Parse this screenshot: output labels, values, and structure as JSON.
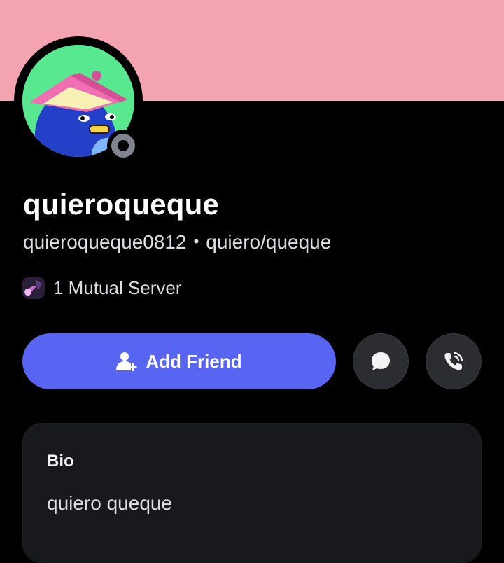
{
  "profile": {
    "banner_color": "#f4a3b1",
    "avatar_icon": "duck-with-book-hat-avatar",
    "status": "offline",
    "display_name": "quieroqueque",
    "username": "quieroqueque0812",
    "separator": "•",
    "pronouns": "quiero/queque"
  },
  "mutual": {
    "server_icon": "server-icon",
    "label": "1 Mutual Server"
  },
  "actions": {
    "add_friend_label": "Add Friend",
    "add_friend_icon": "person-add-icon",
    "message_icon": "chat-bubble-icon",
    "call_icon": "phone-call-icon",
    "accent": "#5865f2"
  },
  "bio": {
    "title": "Bio",
    "text": "quiero queque"
  }
}
